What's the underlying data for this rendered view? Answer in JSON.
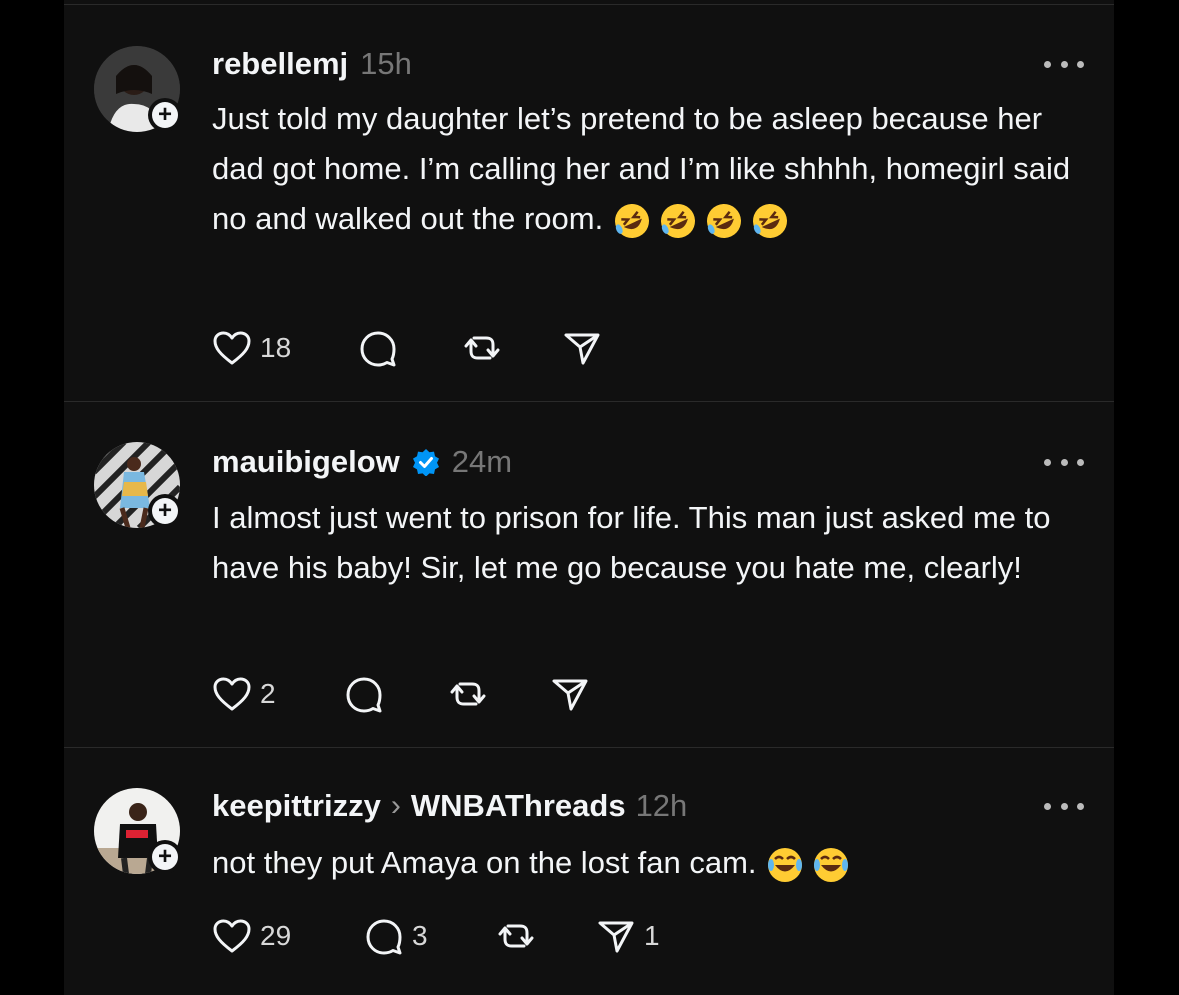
{
  "posts": [
    {
      "username": "rebellemj",
      "time": "15h",
      "text": "Just told my daughter let’s pretend to be asleep because her dad got home. I’m calling her and I’m like shhhh, homegirl said no and walked out the room.",
      "emoji": "rolling-on-floor-laughing x4",
      "likes": "18",
      "replies": "",
      "reposts": "",
      "shares": ""
    },
    {
      "username": "mauibigelow",
      "verified": true,
      "time": "24m",
      "text": "I almost just went to prison for life. This man just asked me to have his baby! Sir, let me go because you hate me, clearly!",
      "likes": "2",
      "replies": "",
      "reposts": "",
      "shares": ""
    },
    {
      "username": "keepittrizzy",
      "reply_to": "WNBAThreads",
      "time": "12h",
      "text": "not they put Amaya on the lost fan cam.",
      "emoji": "face-with-tears-of-joy x2",
      "likes": "29",
      "replies": "3",
      "reposts": "",
      "shares": "1"
    }
  ],
  "icons": {
    "follow": "plus-icon",
    "more": "more-icon",
    "like": "heart-icon",
    "reply": "comment-icon",
    "repost": "repost-icon",
    "share": "send-icon",
    "verified": "verified-badge-icon"
  },
  "colors": {
    "background": "#101010",
    "text": "#f3f5f7",
    "muted": "#777777",
    "verified": "#0095f6",
    "emoji": "#ffcc33"
  }
}
